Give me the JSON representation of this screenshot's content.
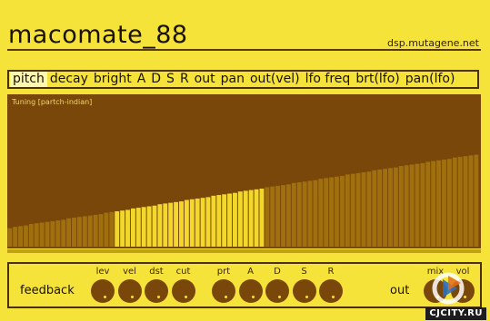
{
  "app": {
    "title": "macomate_88",
    "website": "dsp.mutagene.net"
  },
  "tabs": [
    {
      "label": "pitch",
      "active": true
    },
    {
      "label": "decay"
    },
    {
      "label": "bright"
    },
    {
      "label": "A"
    },
    {
      "label": "D"
    },
    {
      "label": "S"
    },
    {
      "label": "R"
    },
    {
      "label": "out"
    },
    {
      "label": "pan"
    },
    {
      "label": "out(vel)"
    },
    {
      "label": "lfo freq"
    },
    {
      "label": "brt(lfo)"
    },
    {
      "label": "pan(lfo)"
    }
  ],
  "editor": {
    "label": "Tuning [partch-indian]",
    "bar_count": 88,
    "levels": [
      0.13,
      0.14,
      0.145,
      0.15,
      0.16,
      0.165,
      0.17,
      0.175,
      0.18,
      0.185,
      0.19,
      0.2,
      0.205,
      0.21,
      0.215,
      0.22,
      0.225,
      0.23,
      0.24,
      0.245,
      0.25,
      0.255,
      0.26,
      0.27,
      0.275,
      0.28,
      0.285,
      0.29,
      0.3,
      0.305,
      0.31,
      0.315,
      0.32,
      0.33,
      0.335,
      0.34,
      0.345,
      0.35,
      0.36,
      0.365,
      0.37,
      0.375,
      0.38,
      0.39,
      0.395,
      0.4,
      0.405,
      0.41,
      0.42,
      0.425,
      0.43,
      0.435,
      0.44,
      0.45,
      0.455,
      0.46,
      0.465,
      0.47,
      0.48,
      0.485,
      0.49,
      0.495,
      0.5,
      0.51,
      0.515,
      0.52,
      0.525,
      0.53,
      0.54,
      0.545,
      0.55,
      0.555,
      0.56,
      0.57,
      0.575,
      0.58,
      0.585,
      0.59,
      0.6,
      0.605,
      0.61,
      0.615,
      0.62,
      0.63,
      0.635,
      0.64,
      0.645,
      0.65
    ],
    "highlight_range": [
      20,
      47
    ],
    "colors": {
      "background": "#7a470b",
      "bar": "#a0700e",
      "highlight": "#f2d82c"
    }
  },
  "feedback": {
    "section_label": "feedback",
    "knobs": [
      {
        "id": "lev",
        "label": "lev"
      },
      {
        "id": "vel",
        "label": "vel"
      },
      {
        "id": "dst",
        "label": "dst"
      },
      {
        "id": "cut",
        "label": "cut"
      },
      {
        "id": "prt",
        "label": "prt"
      },
      {
        "id": "A",
        "label": "A"
      },
      {
        "id": "D",
        "label": "D"
      },
      {
        "id": "S",
        "label": "S"
      },
      {
        "id": "R",
        "label": "R"
      }
    ]
  },
  "out": {
    "section_label": "out",
    "knobs": [
      {
        "id": "mix",
        "label": "mix"
      },
      {
        "id": "vol",
        "label": "vol"
      }
    ]
  },
  "overlay": {
    "credit": "CJCITY.RU"
  },
  "colors": {
    "background": "#f6e33a",
    "dark": "#7a470b",
    "border": "#4a2e05"
  }
}
